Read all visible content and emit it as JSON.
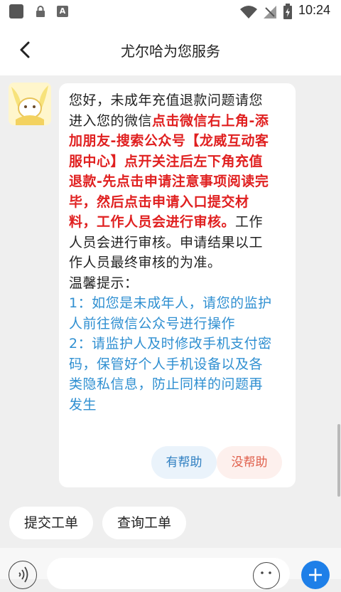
{
  "status_bar": {
    "time": "10:24"
  },
  "header": {
    "title": "尤尔哈为您服务"
  },
  "message": {
    "part1": "您好，未成年充值退款问题请您进入您的微信",
    "part2_highlight": "点击微信右上角-添加朋友-搜索公众号【龙威互动客服中心】点开关注后左下角充值退款-先点击申请注意事项阅读完毕，然后点击申请入口提交材料，工作人员会进行审核。",
    "part3": "工作人员会进行审核。申请结果以工作人员最终审核的为准。",
    "tips_title": "温馨提示：",
    "tip1": "1：如您是未成年人，请您的监护人前往微信公众号进行操作",
    "tip2": "2：请监护人及时修改手机支付密码，保管好个人手机设备以及各类隐私信息，防止同样的问题再发生"
  },
  "feedback": {
    "helpful": "有帮助",
    "unhelpful": "没帮助"
  },
  "quick_actions": [
    "提交工单",
    "查询工单"
  ],
  "colors": {
    "accent_blue": "#1e7fe8",
    "highlight_red": "#e02020",
    "tip_blue": "#2f8fd1"
  }
}
